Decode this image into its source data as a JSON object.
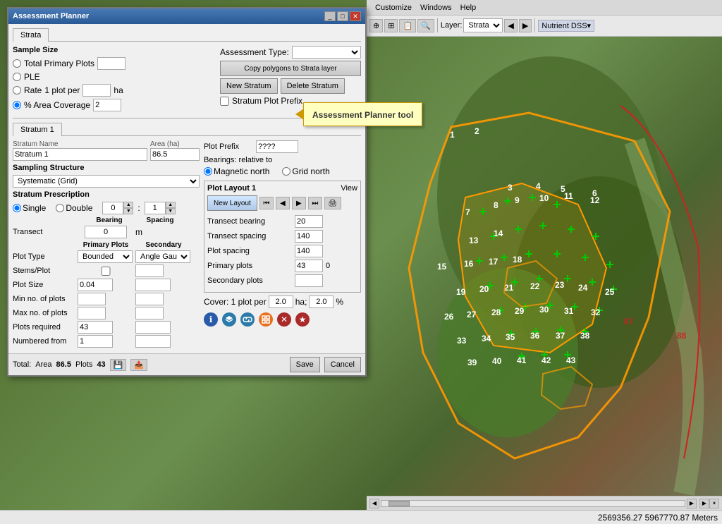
{
  "app": {
    "title": "Assessment Planner",
    "main_title": "Assessment Planner"
  },
  "toolbar": {
    "menus": [
      "Customize",
      "Windows",
      "Help"
    ],
    "layer_label": "Layer:",
    "layer_value": "Strata",
    "nutrient_label": "Nutrient DSS▾"
  },
  "dialog": {
    "title": "Assessment Planner",
    "tab": "Strata",
    "stratum_tab": "Stratum 1"
  },
  "sample_size": {
    "label": "Sample Size",
    "options": [
      "Total Primary Plots",
      "PLE",
      "Rate",
      "% Area Coverage"
    ],
    "selected": "% Area Coverage",
    "rate_label": "1 plot per",
    "rate_unit": "ha",
    "area_value": "2"
  },
  "assessment_type": {
    "label": "Assessment Type:"
  },
  "buttons": {
    "copy_polygons": "Copy polygons to Strata layer",
    "new_stratum": "New Stratum",
    "delete_stratum": "Delete Stratum",
    "stratum_plot_prefix": "Stratum Plot Prefix",
    "save": "Save",
    "cancel": "Cancel",
    "new_layout": "New Layout"
  },
  "stratum": {
    "name_label": "Stratum Name",
    "area_label": "Area (ha)",
    "name_value": "Stratum 1",
    "area_value": "86.5",
    "plot_prefix_label": "Plot Prefix",
    "plot_prefix_value": "????"
  },
  "sampling_structure": {
    "label": "Sampling Structure",
    "value": "Systematic (Grid)"
  },
  "bearings": {
    "label": "Bearings: relative to",
    "options": [
      "Magnetic north",
      "Grid north"
    ],
    "selected": "Magnetic north"
  },
  "stratum_prescription": {
    "label": "Stratum Prescription",
    "single_label": "Single",
    "double_label": "Double",
    "spinner1": "0",
    "spinner2": "1",
    "bearing_label": "Bearing",
    "spacing_label": "Spacing",
    "transect_label": "Transect",
    "transect_bearing": "0",
    "transect_unit": "m"
  },
  "plot_layout": {
    "label": "Plot Layout 1",
    "view_label": "View",
    "transect_bearing_label": "Transect bearing",
    "transect_bearing_value": "20",
    "transect_spacing_label": "Transect spacing",
    "transect_spacing_value": "140",
    "plot_spacing_label": "Plot spacing",
    "plot_spacing_value": "140",
    "primary_plots_label": "Primary plots",
    "primary_plots_value": "43",
    "primary_plots_extra": "0",
    "secondary_plots_label": "Secondary plots",
    "secondary_plots_value": ""
  },
  "plot_table": {
    "headers": [
      "",
      "Primary Plots",
      "Secondary"
    ],
    "plot_type_label": "Plot Type",
    "plot_type_value": "Bounded",
    "plot_type_secondary": "Angle Gaug▾",
    "stems_plot_label": "Stems/Plot",
    "plot_size_label": "Plot Size",
    "plot_size_value": "0.04",
    "min_plots_label": "Min no. of plots",
    "max_plots_label": "Max no. of plots",
    "plots_required_label": "Plots required",
    "plots_required_value": "43",
    "numbered_from_label": "Numbered from",
    "numbered_from_value": "1"
  },
  "cover": {
    "label": "Cover: 1 plot per",
    "value1": "2.0",
    "unit1": "ha;",
    "value2": "2.0",
    "unit2": "%"
  },
  "status": {
    "total_label": "Total:",
    "area_label": "Area",
    "area_value": "86.5",
    "plots_label": "Plots",
    "plots_value": "43"
  },
  "coordinates": "2569356.27  5967770.87 Meters",
  "tooltip": {
    "text": "Assessment Planner tool"
  },
  "icons": {
    "info": "ℹ",
    "layers": "⊞",
    "link": "⛓",
    "grid": "⊕",
    "cross": "✕",
    "star": "★",
    "print": "🖨",
    "prev_first": "⏮",
    "prev": "◀",
    "next": "▶",
    "next_last": "⏭"
  }
}
